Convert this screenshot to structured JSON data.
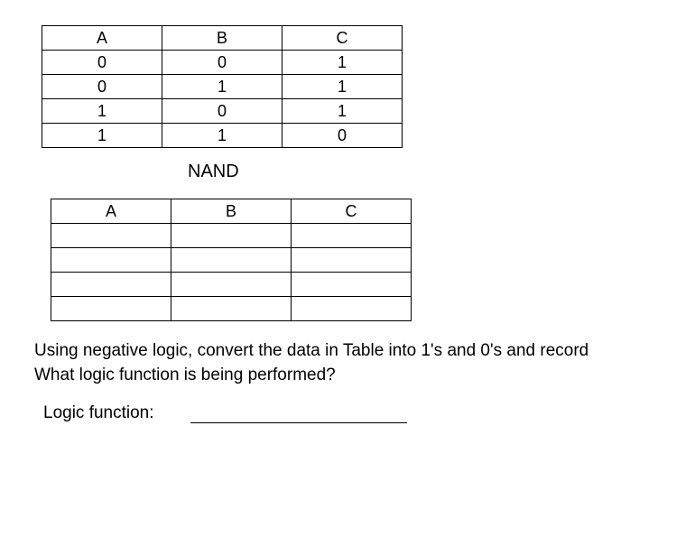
{
  "table1": {
    "headers": [
      "A",
      "B",
      "C"
    ],
    "rows": [
      [
        "0",
        "0",
        "1"
      ],
      [
        "0",
        "1",
        "1"
      ],
      [
        "1",
        "0",
        "1"
      ],
      [
        "1",
        "1",
        "0"
      ]
    ]
  },
  "nand_label": "NAND",
  "table2": {
    "headers": [
      "A",
      "B",
      "C"
    ],
    "rows": [
      [
        "",
        "",
        ""
      ],
      [
        "",
        "",
        ""
      ],
      [
        "",
        "",
        ""
      ],
      [
        "",
        "",
        ""
      ]
    ]
  },
  "question_line1": "Using negative logic, convert the data in Table into 1's and 0's and record",
  "question_line2": "What logic function is being performed?",
  "logic_function_label": "Logic function:",
  "chart_data": [
    {
      "type": "table",
      "title": "NAND",
      "headers": [
        "A",
        "B",
        "C"
      ],
      "rows": [
        {
          "A": 0,
          "B": 0,
          "C": 1
        },
        {
          "A": 0,
          "B": 1,
          "C": 1
        },
        {
          "A": 1,
          "B": 0,
          "C": 1
        },
        {
          "A": 1,
          "B": 1,
          "C": 0
        }
      ]
    },
    {
      "type": "table",
      "title": "",
      "headers": [
        "A",
        "B",
        "C"
      ],
      "rows": [
        {
          "A": "",
          "B": "",
          "C": ""
        },
        {
          "A": "",
          "B": "",
          "C": ""
        },
        {
          "A": "",
          "B": "",
          "C": ""
        },
        {
          "A": "",
          "B": "",
          "C": ""
        }
      ]
    }
  ]
}
